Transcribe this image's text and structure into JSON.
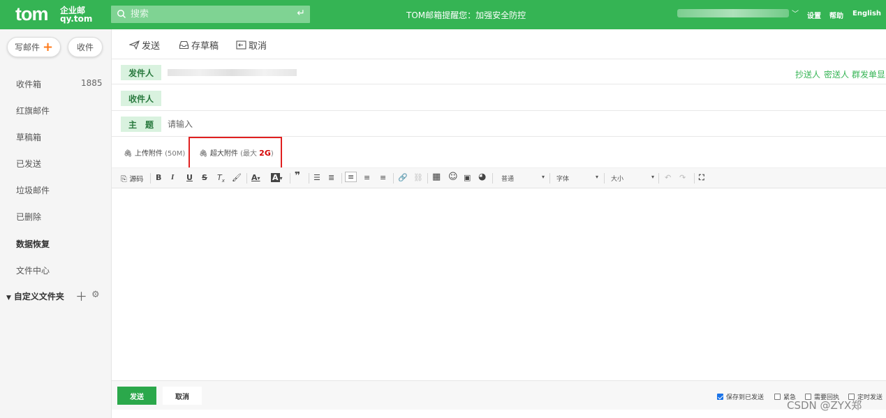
{
  "header": {
    "logo_main": "tom",
    "logo_sub": "企业邮",
    "logo_domain": "qy.tom",
    "search_placeholder": "搜索",
    "notice": "TOM邮箱提醒您：加强安全防控",
    "settings": "设置",
    "help": "帮助",
    "language": "English"
  },
  "sidebar": {
    "compose": "写邮件",
    "receive": "收件",
    "items": [
      {
        "label": "收件箱",
        "count": "1885"
      },
      {
        "label": "红旗邮件"
      },
      {
        "label": "草稿箱"
      },
      {
        "label": "已发送"
      },
      {
        "label": "垃圾邮件"
      },
      {
        "label": "已删除"
      },
      {
        "label": "数据恢复"
      },
      {
        "label": "文件中心"
      }
    ],
    "custom_folders": "自定义文件夹"
  },
  "toolbar": {
    "send": "发送",
    "save_draft": "存草稿",
    "cancel": "取消"
  },
  "compose": {
    "from_label": "发件人",
    "to_label": "收件人",
    "subject_label": "主　题",
    "subject_placeholder": "请输入",
    "cc": "抄送人",
    "bcc": "密送人",
    "group_send": "群发单显",
    "upload_attachment": "上传附件",
    "upload_limit": "(50M)",
    "large_attachment": "超大附件",
    "large_limit_prefix": "(最大",
    "large_limit_value": "2G",
    "large_limit_suffix": ")"
  },
  "editor_toolbar": {
    "source": "源码",
    "paragraph": "普通",
    "font": "字体",
    "size": "大小"
  },
  "bottom": {
    "send": "发送",
    "cancel": "取消",
    "options": [
      {
        "label": "保存到已发送",
        "checked": true
      },
      {
        "label": "紧急",
        "checked": false
      },
      {
        "label": "需要回执",
        "checked": false
      },
      {
        "label": "定时发送",
        "checked": false
      }
    ]
  },
  "watermark": "CSDN @ZYX郑",
  "colors": {
    "brand_green": "#35b454",
    "label_bg": "#d9f2df",
    "highlight_red": "#e02020",
    "checkbox_blue": "#1a73e8"
  }
}
